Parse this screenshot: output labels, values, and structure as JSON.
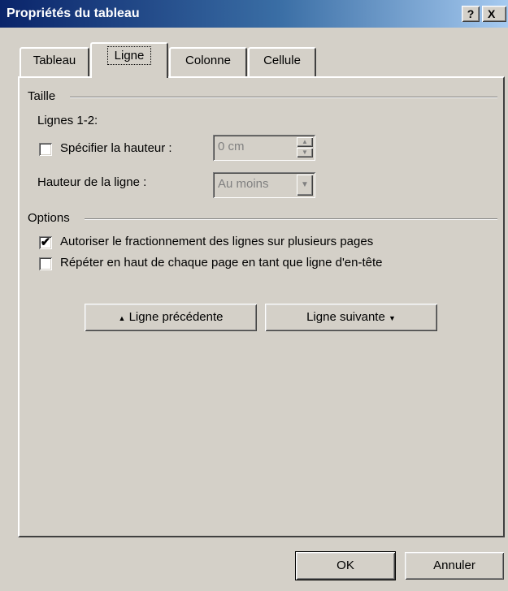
{
  "window": {
    "title": "Propriétés du tableau",
    "help_label": "?",
    "close_label": "X"
  },
  "tabs": [
    {
      "label": "Tableau",
      "active": false
    },
    {
      "label": "Ligne",
      "active": true
    },
    {
      "label": "Colonne",
      "active": false
    },
    {
      "label": "Cellule",
      "active": false
    }
  ],
  "taille": {
    "group_label": "Taille",
    "rows_label": "Lignes 1-2:",
    "specify_height": {
      "label": "Spécifier la hauteur :",
      "checked": false
    },
    "height_value": "0 cm",
    "line_height_label": "Hauteur de la ligne :",
    "line_height_value": "Au moins"
  },
  "options": {
    "group_label": "Options",
    "allow_break": {
      "label": "Autoriser le fractionnement des lignes sur plusieurs pages",
      "checked": true
    },
    "repeat_header": {
      "label": "Répéter en haut de chaque page en tant que ligne d'en-tête",
      "checked": false
    }
  },
  "nav": {
    "prev_label": "Ligne précédente",
    "prev_icon": "▲",
    "next_label": "Ligne suivante",
    "next_icon": "▼"
  },
  "footer": {
    "ok_label": "OK",
    "cancel_label": "Annuler"
  },
  "icons": {
    "check_mark": "✔",
    "spin_up": "▲",
    "spin_down": "▼",
    "dropdown": "▼"
  }
}
